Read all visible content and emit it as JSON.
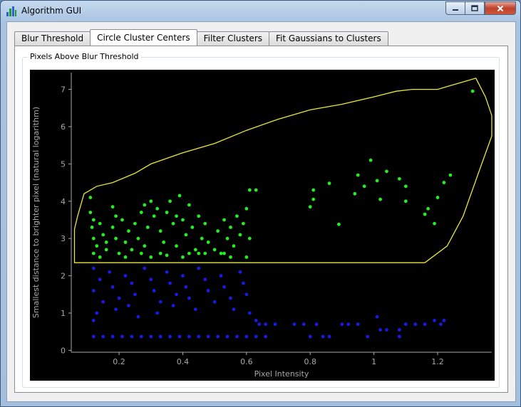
{
  "window": {
    "title": "Algorithm GUI",
    "icon": "algorithm-app-icon",
    "controls": {
      "minimize": "minimize-icon",
      "maximize": "maximize-icon",
      "close": "close-icon"
    }
  },
  "tabs": [
    {
      "label": "Blur Threshold",
      "active": false
    },
    {
      "label": "Circle Cluster Centers",
      "active": true
    },
    {
      "label": "Filter Clusters",
      "active": false
    },
    {
      "label": "Fit Gaussians to Clusters",
      "active": false
    }
  ],
  "group": {
    "title": "Pixels Above Blur Threshold"
  },
  "colors": {
    "background": "#000000",
    "selected": "#22ee22",
    "unselected": "#1a1ae6",
    "boundary": "#e8e83a",
    "axis": "#a8a8a8"
  },
  "chart_data": {
    "type": "scatter",
    "xlabel": "Pixel Intensity",
    "ylabel": "Smallest distance to brighter pixel (natural logarithm)",
    "xlim": [
      0.05,
      1.37
    ],
    "ylim": [
      -0.05,
      7.45
    ],
    "x_ticks": [
      0.2,
      0.4,
      0.6,
      0.8,
      1,
      1.2
    ],
    "x_tick_labels": [
      "0.2",
      "0.4",
      "0.6",
      "0.8",
      "1",
      "1.2"
    ],
    "y_ticks": [
      0,
      1,
      2,
      3,
      4,
      5,
      6,
      7
    ],
    "y_tick_labels": [
      "0",
      "1",
      "2",
      "3",
      "4",
      "5",
      "6",
      "7"
    ],
    "series": [
      {
        "color": "#22ee22",
        "points": [
          [
            0.11,
            4.1
          ],
          [
            0.11,
            3.7
          ],
          [
            0.12,
            3.5
          ],
          [
            0.115,
            3.3
          ],
          [
            0.12,
            3.0
          ],
          [
            0.13,
            2.8
          ],
          [
            0.12,
            2.6
          ],
          [
            0.14,
            3.4
          ],
          [
            0.15,
            3.1
          ],
          [
            0.16,
            2.7
          ],
          [
            0.14,
            2.5
          ],
          [
            0.18,
            3.3
          ],
          [
            0.18,
            3.85
          ],
          [
            0.19,
            3.0
          ],
          [
            0.2,
            2.6
          ],
          [
            0.21,
            3.5
          ],
          [
            0.22,
            2.9
          ],
          [
            0.23,
            3.2
          ],
          [
            0.24,
            2.7
          ],
          [
            0.25,
            3.4
          ],
          [
            0.26,
            3.0
          ],
          [
            0.27,
            2.6
          ],
          [
            0.28,
            3.9
          ],
          [
            0.29,
            3.3
          ],
          [
            0.3,
            4.0
          ],
          [
            0.31,
            3.6
          ],
          [
            0.32,
            3.8
          ],
          [
            0.33,
            3.2
          ],
          [
            0.34,
            2.9
          ],
          [
            0.35,
            3.7
          ],
          [
            0.36,
            4.0
          ],
          [
            0.37,
            3.4
          ],
          [
            0.38,
            2.8
          ],
          [
            0.39,
            4.15
          ],
          [
            0.4,
            3.5
          ],
          [
            0.41,
            3.1
          ],
          [
            0.42,
            3.9
          ],
          [
            0.43,
            3.3
          ],
          [
            0.44,
            2.7
          ],
          [
            0.45,
            3.6
          ],
          [
            0.46,
            3.0
          ],
          [
            0.47,
            3.4
          ],
          [
            0.48,
            2.9
          ],
          [
            0.51,
            3.2
          ],
          [
            0.52,
            2.6
          ],
          [
            0.53,
            3.5
          ],
          [
            0.54,
            3.0
          ],
          [
            0.55,
            3.3
          ],
          [
            0.56,
            2.8
          ],
          [
            0.57,
            3.6
          ],
          [
            0.58,
            3.1
          ],
          [
            0.59,
            3.4
          ],
          [
            0.6,
            3.8
          ],
          [
            0.61,
            3.0
          ],
          [
            0.61,
            4.3
          ],
          [
            0.63,
            4.3
          ],
          [
            0.3,
            2.5
          ],
          [
            0.35,
            2.55
          ],
          [
            0.4,
            2.5
          ],
          [
            0.45,
            2.6
          ],
          [
            0.5,
            2.7
          ],
          [
            0.22,
            2.5
          ],
          [
            0.27,
            3.7
          ],
          [
            0.33,
            2.6
          ],
          [
            0.42,
            2.6
          ],
          [
            0.55,
            2.5
          ],
          [
            0.19,
            3.6
          ],
          [
            0.16,
            2.9
          ],
          [
            0.28,
            2.8
          ],
          [
            0.38,
            3.6
          ],
          [
            0.47,
            2.6
          ],
          [
            0.53,
            2.6
          ],
          [
            0.6,
            2.5
          ],
          [
            0.8,
            3.85
          ],
          [
            0.81,
            4.05
          ],
          [
            0.81,
            4.3
          ],
          [
            0.86,
            4.48
          ],
          [
            0.89,
            3.38
          ],
          [
            0.94,
            4.2
          ],
          [
            0.95,
            4.7
          ],
          [
            0.97,
            4.4
          ],
          [
            0.99,
            5.1
          ],
          [
            1.01,
            4.55
          ],
          [
            1.02,
            4.05
          ],
          [
            1.04,
            4.8
          ],
          [
            1.08,
            4.6
          ],
          [
            1.1,
            4.0
          ],
          [
            1.1,
            4.4
          ],
          [
            1.16,
            3.65
          ],
          [
            1.17,
            3.8
          ],
          [
            1.19,
            3.4
          ],
          [
            1.2,
            4.1
          ],
          [
            1.22,
            4.5
          ],
          [
            1.24,
            4.7
          ],
          [
            1.31,
            6.95
          ]
        ]
      },
      {
        "color": "#1a1ae6",
        "points": [
          [
            0.12,
            2.2
          ],
          [
            0.14,
            1.9
          ],
          [
            0.12,
            1.6
          ],
          [
            0.15,
            1.3
          ],
          [
            0.13,
            1.0
          ],
          [
            0.12,
            0.8
          ],
          [
            0.17,
            2.1
          ],
          [
            0.18,
            1.7
          ],
          [
            0.2,
            1.4
          ],
          [
            0.19,
            1.1
          ],
          [
            0.22,
            2.0
          ],
          [
            0.24,
            1.8
          ],
          [
            0.25,
            1.5
          ],
          [
            0.23,
            1.2
          ],
          [
            0.26,
            0.9
          ],
          [
            0.28,
            2.2
          ],
          [
            0.3,
            1.9
          ],
          [
            0.31,
            1.6
          ],
          [
            0.33,
            1.3
          ],
          [
            0.32,
            1.0
          ],
          [
            0.35,
            2.1
          ],
          [
            0.36,
            1.8
          ],
          [
            0.38,
            1.5
          ],
          [
            0.37,
            1.2
          ],
          [
            0.4,
            2.0
          ],
          [
            0.41,
            1.7
          ],
          [
            0.42,
            1.4
          ],
          [
            0.44,
            1.1
          ],
          [
            0.45,
            2.2
          ],
          [
            0.47,
            1.9
          ],
          [
            0.48,
            1.6
          ],
          [
            0.5,
            1.3
          ],
          [
            0.52,
            2.0
          ],
          [
            0.53,
            1.7
          ],
          [
            0.55,
            1.4
          ],
          [
            0.56,
            1.1
          ],
          [
            0.58,
            2.1
          ],
          [
            0.59,
            1.8
          ],
          [
            0.6,
            1.5
          ],
          [
            0.61,
            1.0
          ],
          [
            0.63,
            0.8
          ],
          [
            0.12,
            0.37
          ],
          [
            0.15,
            0.37
          ],
          [
            0.18,
            0.37
          ],
          [
            0.21,
            0.37
          ],
          [
            0.24,
            0.37
          ],
          [
            0.27,
            0.37
          ],
          [
            0.3,
            0.37
          ],
          [
            0.33,
            0.37
          ],
          [
            0.36,
            0.37
          ],
          [
            0.39,
            0.37
          ],
          [
            0.42,
            0.37
          ],
          [
            0.45,
            0.37
          ],
          [
            0.48,
            0.37
          ],
          [
            0.51,
            0.37
          ],
          [
            0.54,
            0.37
          ],
          [
            0.57,
            0.37
          ],
          [
            0.6,
            0.37
          ],
          [
            0.63,
            0.37
          ],
          [
            0.66,
            0.37
          ],
          [
            0.69,
            0.7
          ],
          [
            0.66,
            0.7
          ],
          [
            0.64,
            0.7
          ],
          [
            0.75,
            0.7
          ],
          [
            0.78,
            0.7
          ],
          [
            0.8,
            0.37
          ],
          [
            0.82,
            0.7
          ],
          [
            0.84,
            0.37
          ],
          [
            0.86,
            0.37
          ],
          [
            0.9,
            0.7
          ],
          [
            0.92,
            0.7
          ],
          [
            0.95,
            0.7
          ],
          [
            0.98,
            0.37
          ],
          [
            1.01,
            0.9
          ],
          [
            1.02,
            0.55
          ],
          [
            1.04,
            0.55
          ],
          [
            1.08,
            0.55
          ],
          [
            1.08,
            0.37
          ],
          [
            1.1,
            0.7
          ],
          [
            1.13,
            0.7
          ],
          [
            1.16,
            0.7
          ],
          [
            1.19,
            0.8
          ],
          [
            1.21,
            0.7
          ],
          [
            1.22,
            0.8
          ]
        ]
      }
    ],
    "boundary": [
      [
        0.06,
        3.25
      ],
      [
        0.07,
        3.6
      ],
      [
        0.09,
        4.2
      ],
      [
        0.13,
        4.4
      ],
      [
        0.18,
        4.5
      ],
      [
        0.25,
        4.75
      ],
      [
        0.3,
        5.0
      ],
      [
        0.4,
        5.3
      ],
      [
        0.5,
        5.55
      ],
      [
        0.6,
        5.9
      ],
      [
        0.7,
        6.2
      ],
      [
        0.8,
        6.45
      ],
      [
        0.9,
        6.6
      ],
      [
        1.0,
        6.8
      ],
      [
        1.07,
        6.95
      ],
      [
        1.12,
        7.0
      ],
      [
        1.2,
        7.0
      ],
      [
        1.26,
        7.15
      ],
      [
        1.32,
        7.3
      ],
      [
        1.35,
        6.8
      ],
      [
        1.37,
        6.3
      ],
      [
        1.37,
        5.75
      ],
      [
        1.33,
        4.8
      ],
      [
        1.28,
        3.6
      ],
      [
        1.23,
        2.8
      ],
      [
        1.16,
        2.35
      ],
      [
        0.06,
        2.35
      ],
      [
        0.06,
        2.7
      ],
      [
        0.06,
        3.25
      ]
    ]
  }
}
